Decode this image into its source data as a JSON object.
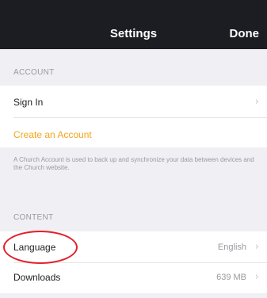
{
  "nav": {
    "title": "Settings",
    "done_label": "Done"
  },
  "account": {
    "header": "ACCOUNT",
    "sign_in_label": "Sign In",
    "create_account_label": "Create an Account",
    "note": "A Church Account is used to back up and synchronize your data between devices and the Church website."
  },
  "content": {
    "header": "CONTENT",
    "language_label": "Language",
    "language_value": "English",
    "downloads_label": "Downloads",
    "downloads_value": "639 MB"
  },
  "annotation": {
    "circle_color": "#e0212b"
  },
  "icons": {
    "chevron": "chevron-right-icon"
  }
}
